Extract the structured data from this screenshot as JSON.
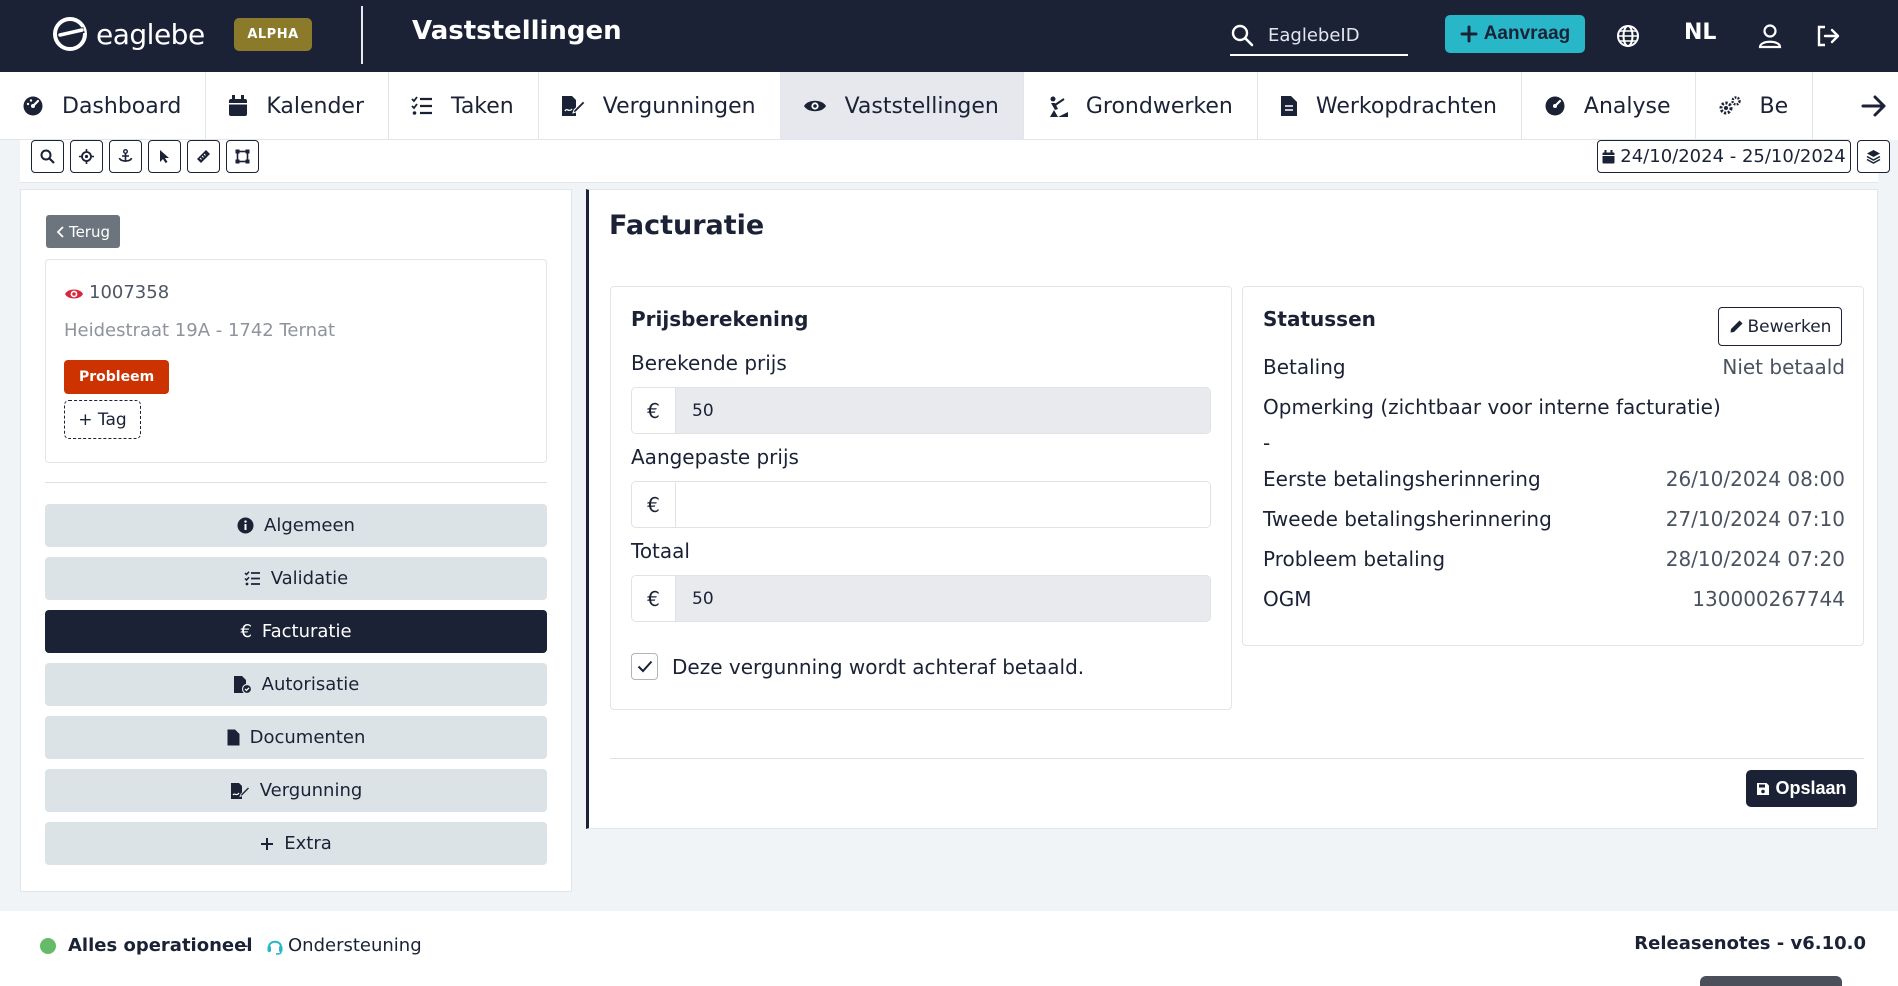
{
  "app": {
    "logo_text": "eaglebe",
    "badge": "ALPHA",
    "page_title": "Vaststellingen",
    "search_placeholder": "EaglebeID",
    "aanvraag_label": "Aanvraag",
    "language": "NL"
  },
  "nav": {
    "tabs": [
      {
        "label": "Dashboard",
        "icon": "gauge-icon"
      },
      {
        "label": "Kalender",
        "icon": "calendar-icon"
      },
      {
        "label": "Taken",
        "icon": "list-check-icon"
      },
      {
        "label": "Vergunningen",
        "icon": "file-signature-icon"
      },
      {
        "label": "Vaststellingen",
        "icon": "eye-icon",
        "active": true
      },
      {
        "label": "Grondwerken",
        "icon": "digging-icon"
      },
      {
        "label": "Werkopdrachten",
        "icon": "file-icon"
      },
      {
        "label": "Analyse",
        "icon": "gauge-icon"
      },
      {
        "label": "Be",
        "icon": "gears-icon"
      }
    ]
  },
  "toolbar": {
    "date_range": "24/10/2024 - 25/10/2024"
  },
  "record": {
    "back_label": "Terug",
    "id": "1007358",
    "address": "Heidestraat 19A - 1742 Ternat",
    "status_badge": "Probleem",
    "tag_button": "+ Tag"
  },
  "sidemenu": {
    "items": [
      {
        "label": "Algemeen",
        "icon": "info-circle-icon"
      },
      {
        "label": "Validatie",
        "icon": "list-check-icon"
      },
      {
        "label": "Facturatie",
        "icon": "euro-icon",
        "active": true
      },
      {
        "label": "Autorisatie",
        "icon": "file-shield-icon"
      },
      {
        "label": "Documenten",
        "icon": "file-icon"
      },
      {
        "label": "Vergunning",
        "icon": "file-signature-icon"
      },
      {
        "label": "Extra",
        "icon": "plus-icon"
      }
    ]
  },
  "facturatie": {
    "title": "Facturatie",
    "pricing": {
      "heading": "Prijsberekening",
      "calculated_label": "Berekende prijs",
      "calculated_value": "50",
      "adjusted_label": "Aangepaste prijs",
      "adjusted_value": "",
      "total_label": "Totaal",
      "total_value": "50",
      "currency": "€",
      "postpaid_label": "Deze vergunning wordt achteraf betaald.",
      "postpaid_checked": true
    },
    "statuses": {
      "heading": "Statussen",
      "edit_label": "Bewerken",
      "payment_label": "Betaling",
      "payment_value": "Niet betaald",
      "remark_label": "Opmerking (zichtbaar voor interne facturatie)",
      "remark_value": "-",
      "first_reminder_label": "Eerste betalingsherinnering",
      "first_reminder_value": "26/10/2024 08:00",
      "second_reminder_label": "Tweede betalingsherinnering",
      "second_reminder_value": "27/10/2024 07:10",
      "problem_label": "Probleem betaling",
      "problem_value": "28/10/2024 07:20",
      "ogm_label": "OGM",
      "ogm_value": "130000267744"
    },
    "save_label": "Opslaan"
  },
  "footer": {
    "status": "Alles operationeel",
    "dash": "-",
    "support": "Ondersteuning",
    "release": "Releasenotes - v6.10.0"
  },
  "colors": {
    "navy": "#1b2236",
    "accent": "#27b7c9",
    "problem": "#cc3300",
    "alpha_badge": "#8a7a2a",
    "ok": "#66bb6a"
  }
}
